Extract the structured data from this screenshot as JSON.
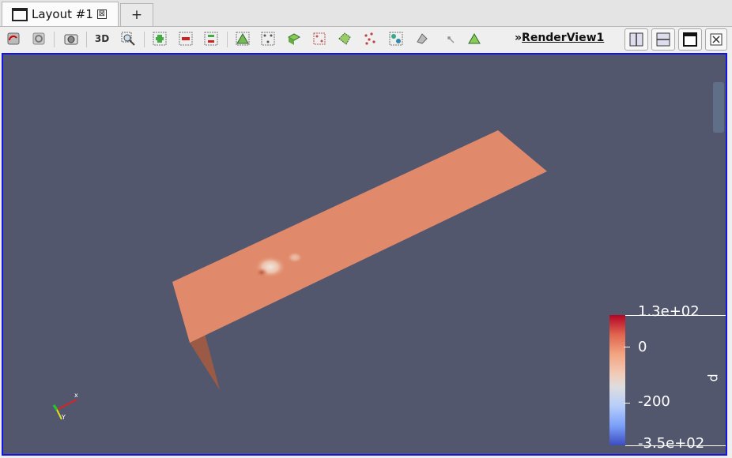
{
  "tabs": [
    {
      "label": "Layout #1",
      "close_glyph": "⊠"
    }
  ],
  "add_tab_label": "+",
  "toolbar": {
    "buttons": [
      "reset-camera-icon",
      "zoom-to-data-icon",
      "capture-screenshot-icon",
      "3d-toggle",
      "zoom-to-box-icon",
      "add-selection-icon",
      "subtract-selection-icon",
      "toggle-selection-icon",
      "select-cells-on-icon",
      "select-points-on-icon",
      "select-cells-through-icon",
      "select-points-through-icon",
      "select-cells-polygon-icon",
      "select-points-polygon-icon",
      "interactive-select-cells-icon",
      "interactive-select-points-icon",
      "hover-points-icon",
      "hover-cells-icon"
    ],
    "text_3d": "3D",
    "overflow_glyph": "»",
    "view_name": "RenderView1"
  },
  "legend": {
    "title": "p",
    "labels": [
      "1.3e+02",
      "0",
      "-200",
      "-3.5e+02"
    ],
    "colors": {
      "top": "#b40426",
      "mid": "#dddddd",
      "bottom": "#3b4cc0"
    }
  },
  "colors": {
    "background": "#52576e",
    "surface": "#e08a6b",
    "active_border": "#1414e6"
  }
}
